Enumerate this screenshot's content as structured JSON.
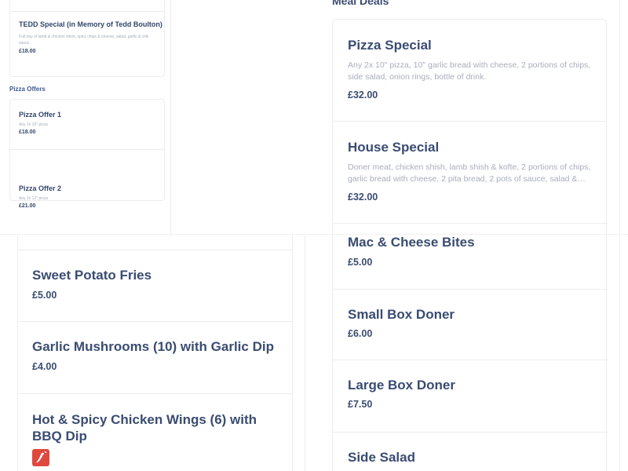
{
  "sidebar_top_item": {
    "title": "TEDD Special (in Memory of Tedd Boulton)",
    "description": "Full tray of lamb & chicken shish, spicy chips & cheese, salad, garlic & chili sauce.",
    "price": "£18.00"
  },
  "pizza_offers": {
    "heading": "Pizza Offers",
    "items": [
      {
        "title": "Pizza Offer 1",
        "description": "Any 2x 10\" pizza",
        "price": "£18.00"
      },
      {
        "title": "Pizza Offer 2",
        "description": "Any 2x 12\" pizza",
        "price": "£21.00"
      }
    ]
  },
  "meal_deals": {
    "heading": "Meal Deals",
    "items": [
      {
        "title": "Pizza Special",
        "description": "Any 2x 10\" pizza, 10\" garlic bread with cheese, 2 portions of chips, side salad, onion rings, bottle of drink.",
        "price": "£32.00"
      },
      {
        "title": "House Special",
        "description": "Doner meat, chicken shish, lamb shish & kofte, 2 portions of chips, garlic bread with cheese, 2 pita bread, 2 pots of sauce, salad &…",
        "price": "£32.00"
      }
    ]
  },
  "sides_left": {
    "items": [
      {
        "title": "Sweet Potato Fries",
        "price": "£5.00"
      },
      {
        "title": "Garlic Mushrooms (10) with Garlic Dip",
        "price": "£4.00"
      },
      {
        "title": "Hot & Spicy Chicken Wings (6) with BBQ Dip",
        "icon": "chili-pepper-icon"
      }
    ]
  },
  "sides_right": {
    "items": [
      {
        "title": "Mac & Cheese Bites",
        "price": "£5.00"
      },
      {
        "title": "Small Box Doner",
        "price": "£6.00"
      },
      {
        "title": "Large Box Doner",
        "price": "£7.50"
      },
      {
        "title": "Side Salad"
      }
    ]
  },
  "colors": {
    "title": "#3a4c72",
    "description": "#a8aebb",
    "section_heading": "#3e5a96",
    "spicy_badge": "#e0483e",
    "border": "#ececec"
  }
}
